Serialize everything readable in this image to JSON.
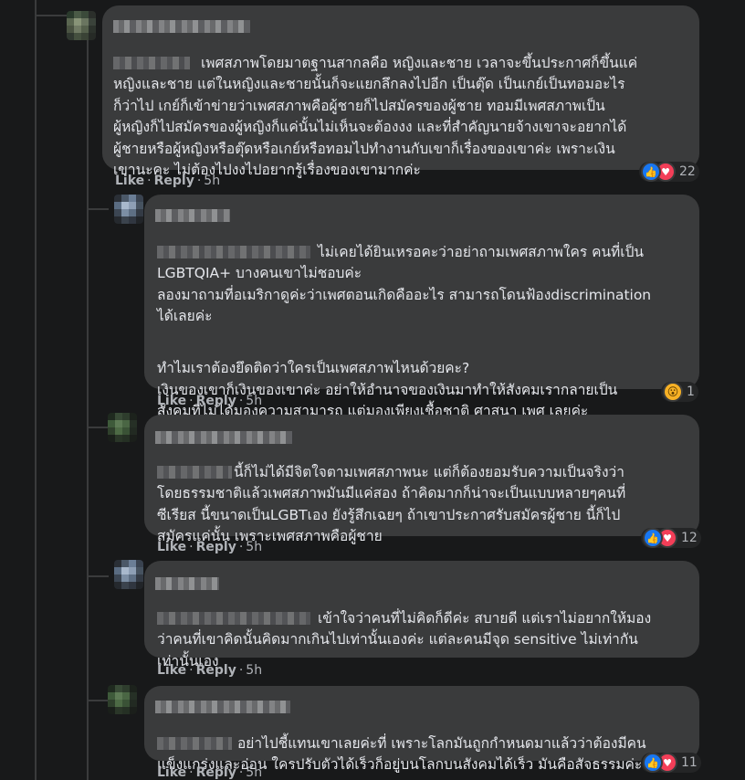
{
  "comments": [
    {
      "text": "เพศสภาพโดยมาตฐานสากลคือ หญิงและชาย เวลาจะขึ้นประกาศก็ขึ้นแค่\nหญิงและชาย แต่ในหญิงและชายนั้นก็จะแยกลึกลงไปอีก เป็นตุ๊ด เป็นเกย์เป็นทอมอะไร\nก็ว่าไป เกย์ก็เข้าข่ายว่าเพศสภาพคือผู้ชายก็ไปสมัครของผู้ชาย ทอมมีเพศสภาพเป็น\nผู้หญิงก็ไปสมัครของผู้หญิงก็แค่นั้นไม่เห็นจะต้องงง และที่สำคัญนายจ้างเขาจะอยากได้\nผู้ชายหรือผู้หญิงหรือตุ๊ดหรือเกย์หรือทอมไปทำงานกับเขาก็เรื่องของเขาค่ะ เพราะเงิน\nเขานะคะ ไม่ต้องไปงงไปอยากรู้เรื่องของเขามากค่ะ",
      "like": "Like",
      "reply": "Reply",
      "time": "5h",
      "reaction_count": "22",
      "reaction_icons": [
        "like-icon",
        "love-icon"
      ]
    },
    {
      "paragraphs": [
        "ไม่เคยได้ยินเหรอคะว่าอย่าถามเพศสภาพใคร คนที่เป็น\nLGBTQIA+ บางคนเขาไม่ชอบค่ะ\nลองมาถามที่อเมริกาดูค่ะว่าเพศตอนเกิดคืออะไร สามารถโดนฟ้องdiscrimination\nได้เลยค่ะ",
        "ทำไมเราต้องยึดติดว่าใครเป็นเพศสภาพไหนด้วยคะ?\nเงินของเขาก็เงินของเขาค่ะ อย่าให้อำนาจของเงินมาทำให้สังคมเรากลายเป็น\nสังคมที่ไม่ได้มองความสามารถ แต่มองเพียงเชื้อชาติ ศาสนา เพศ เลยค่ะ"
      ],
      "like": "Like",
      "reply": "Reply",
      "time": "5h",
      "reaction_count": "1",
      "reaction_icons": [
        "wow-icon"
      ]
    },
    {
      "text": "นี้ก็ไม่ได้มีจิตใจตามเพศสภาพนะ แต่ก็ต้องยอมรับความเป็นจริงว่า\nโดยธรรมชาติแล้วเพศสภาพมันมีแค่สอง ถ้าคิดมากก็น่าจะเป็นแบบหลายๆคนที่\nซีเรียส นี้ขนาดเป็นLGBTเอง ยังรู้สึกเฉยๆ ถ้าเขาประกาศรับสมัครผู้ชาย นี้ก็ไป\nสมัครแค่นั้น เพราะเพศสภาพคือผู้ชาย",
      "like": "Like",
      "reply": "Reply",
      "time": "5h",
      "reaction_count": "12",
      "reaction_icons": [
        "like-icon",
        "love-icon"
      ]
    },
    {
      "text": "เข้าใจว่าคนที่ไม่คิดก็ดีค่ะ สบายดี แต่เราไม่อยากให้มอง\nว่าคนที่เขาคิดนั้นคิดมากเกินไปเท่านั้นเองค่ะ แต่ละคนมีจุด sensitive ไม่เท่ากัน\nเท่านั้นเอง",
      "like": "Like",
      "reply": "Reply",
      "time": "5h"
    },
    {
      "text": "อย่าไปชี้แทนเขาเลยค่ะที่ เพราะโลกมันถูกกำหนดมาแล้วว่าต้องมีคน\nแข็งแกร่งและอ่อน ใครปรับตัวได้เร็วก็อยู่บนโลกบนสังคมได้เร็ว มันคือสัจธรรมค่ะ",
      "like": "Like",
      "reply": "Reply",
      "time": "5h",
      "reaction_count": "11",
      "reaction_icons": [
        "like-icon",
        "love-icon"
      ]
    }
  ],
  "colors": {
    "background": "#18191a",
    "bubble": "#3a3b3c",
    "text": "#e4e6eb",
    "meta": "#b0b3b8",
    "like_blue": "#1877f2",
    "love_red": "#f33e58",
    "wow_yellow": "#f7b125"
  }
}
